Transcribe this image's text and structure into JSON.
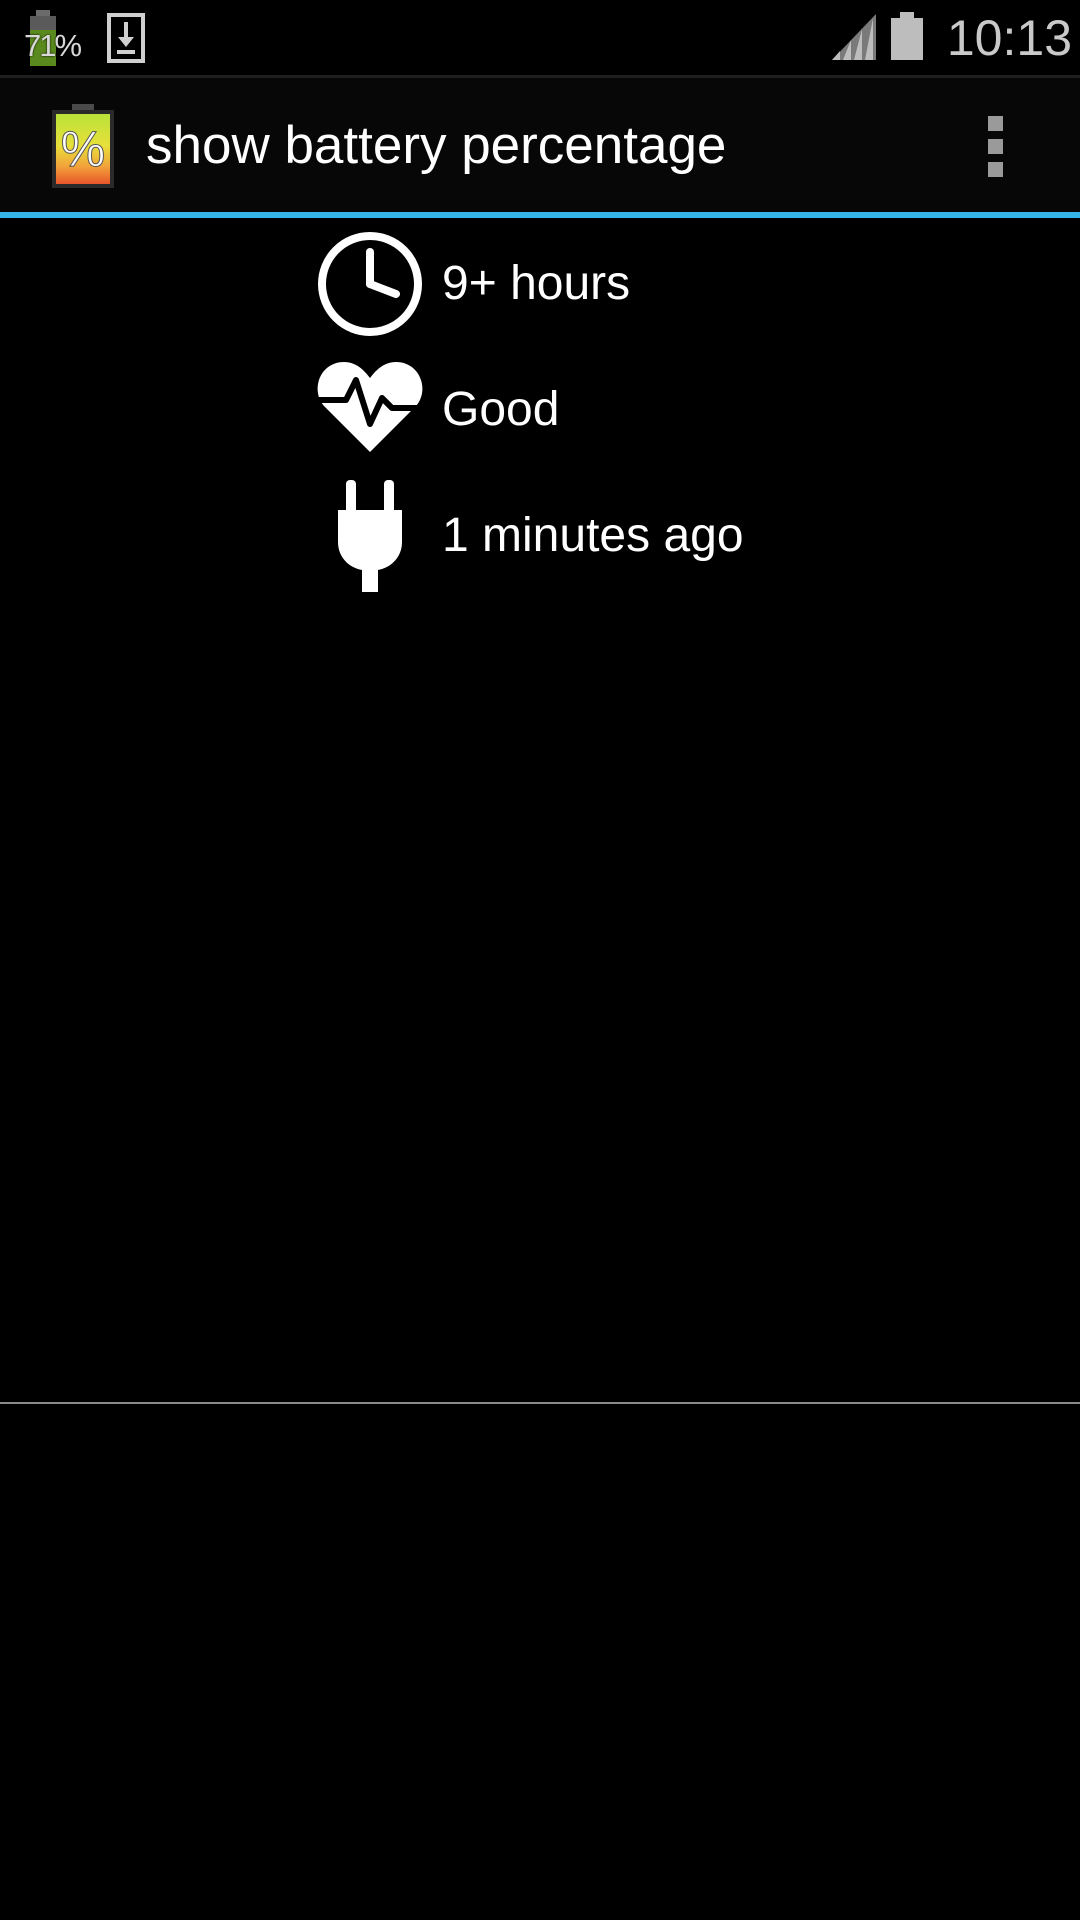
{
  "status_bar": {
    "notification_battery_text": "71%",
    "clock": "10:13",
    "icons": [
      "battery-percent-notification-icon",
      "download-icon",
      "signal-icon",
      "battery-icon"
    ]
  },
  "action_bar": {
    "title": "show battery percentage",
    "app_icon": "battery-percentage-app-icon",
    "menu_icon": "overflow-menu-icon",
    "accent_color": "#33b5e5"
  },
  "info": {
    "time_remaining": "9+ hours",
    "health": "Good",
    "last_plugged": "1 minutes ago",
    "icons": [
      "clock-icon",
      "heart-pulse-icon",
      "plug-icon"
    ]
  },
  "colors": {
    "background": "#000000",
    "action_bar": "#070707",
    "text": "#ffffff",
    "status_text": "#c9c9c9"
  }
}
